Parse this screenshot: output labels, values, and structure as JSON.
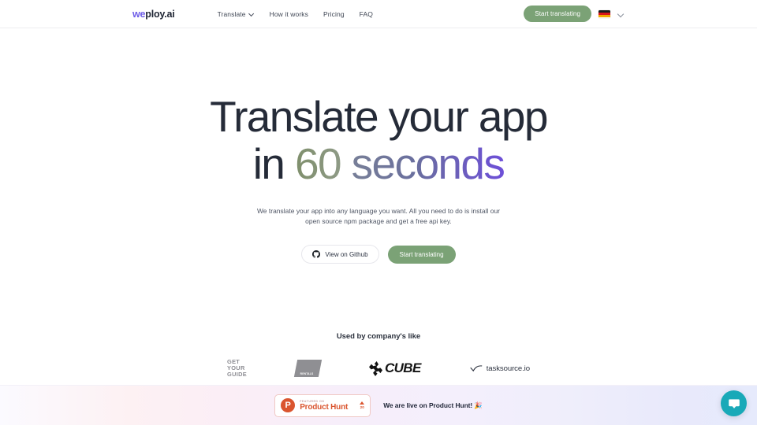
{
  "header": {
    "logo": {
      "primary": "we",
      "secondary": "ploy.ai",
      "name": "weploy.ai"
    },
    "nav": [
      {
        "label": "Translate",
        "has_dropdown": true
      },
      {
        "label": "How it works",
        "has_dropdown": false
      },
      {
        "label": "Pricing",
        "has_dropdown": false
      },
      {
        "label": "FAQ",
        "has_dropdown": false
      }
    ],
    "cta_label": "Start translating",
    "language": {
      "flag": "de",
      "label": "German",
      "chevron": "chevron-down-icon"
    }
  },
  "hero": {
    "headline_line1": "Translate your app",
    "headline_line2_prefix": "in ",
    "headline_line2_number": "60",
    "headline_line2_suffix": " seconds",
    "subtitle": "We translate your app into any language you want. All you need to do is install our open source npm package and get a free api key.",
    "buttons": {
      "github_label": "View on Github",
      "primary_label": "Start translating"
    }
  },
  "social_proof": {
    "title": "Used by company's like",
    "logos": [
      {
        "name": "getyourguide",
        "line1": "GET",
        "line2": "YOUR",
        "line3": "GUIDE"
      },
      {
        "name": "rentals",
        "text": "RENTALS"
      },
      {
        "name": "cube",
        "text": "CUBE"
      },
      {
        "name": "tasksource",
        "text": "tasksource.io"
      }
    ]
  },
  "bottom_bar": {
    "product_hunt": {
      "initial": "P",
      "featured_text": "FEATURED ON",
      "name": "Product Hunt",
      "vote_count": "20"
    },
    "live_text": "We are live on Product Hunt! 🎉"
  },
  "chat_widget": {
    "icon": "chat-bubble-icon",
    "color": "#19a9b8"
  },
  "colors": {
    "brand_purple": "#6d5ce7",
    "accent_green": "#7ba276",
    "product_hunt_orange": "#da552f",
    "chat_teal": "#19a9b8",
    "text_dark": "#1e2433"
  }
}
